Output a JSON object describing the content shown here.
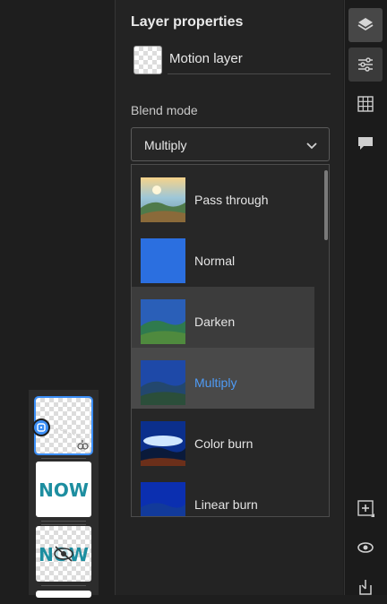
{
  "panel": {
    "title": "Layer properties",
    "layer_name": "Motion layer",
    "blend_label": "Blend mode",
    "blend_value": "Multiply"
  },
  "blend_options": [
    {
      "label": "Pass through"
    },
    {
      "label": "Normal"
    },
    {
      "label": "Darken"
    },
    {
      "label": "Multiply"
    },
    {
      "label": "Color burn"
    },
    {
      "label": "Linear burn"
    }
  ],
  "layers": [
    {
      "type": "motion",
      "badge": "link-icon"
    },
    {
      "text": "NOW"
    },
    {
      "text": "NOW",
      "hidden_icon": "eye-slash-icon"
    }
  ],
  "rail": {
    "icons": [
      "layers-icon",
      "sliders-icon",
      "grid-icon",
      "comment-icon",
      "add-layer-icon",
      "visibility-icon",
      "export-icon"
    ]
  },
  "colors": {
    "accent": "#4f9bf5",
    "selected_option_bg": "#494949"
  }
}
